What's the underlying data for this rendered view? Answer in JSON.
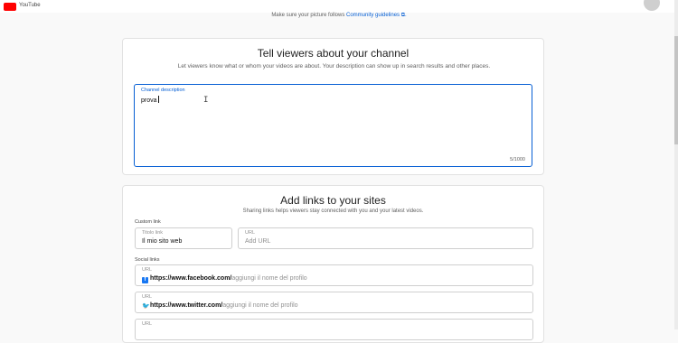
{
  "header": {
    "app_name": "YouTube"
  },
  "picture_notice": {
    "text": "Make sure your picture follows ",
    "link": "Community guidelines ⧉."
  },
  "about": {
    "title": "Tell viewers about your channel",
    "subtitle": "Let viewers know what or whom your videos are about. Your description can show up in search results and other places.",
    "description": {
      "label": "Channel description",
      "value": "prova",
      "counter": "5/1000"
    }
  },
  "links": {
    "title": "Add links to your sites",
    "subtitle": "Sharing links helps viewers stay connected with you and your latest videos.",
    "custom_label": "Custom link",
    "custom": {
      "title_label": "Titolo link",
      "title_value": "Il mio sito web",
      "url_label": "URL",
      "url_placeholder": "Add URL"
    },
    "social_label": "Social links",
    "social": [
      {
        "label": "URL",
        "icon": "facebook-icon",
        "base": "https://www.facebook.com/",
        "hint": "aggiungi il nome del profilo"
      },
      {
        "label": "URL",
        "icon": "twitter-icon",
        "base": "https://www.twitter.com/",
        "hint": "aggiungi il nome del profilo"
      },
      {
        "label": "URL"
      }
    ]
  },
  "colors": {
    "accent": "#065fd4",
    "brand": "#ff0000"
  }
}
